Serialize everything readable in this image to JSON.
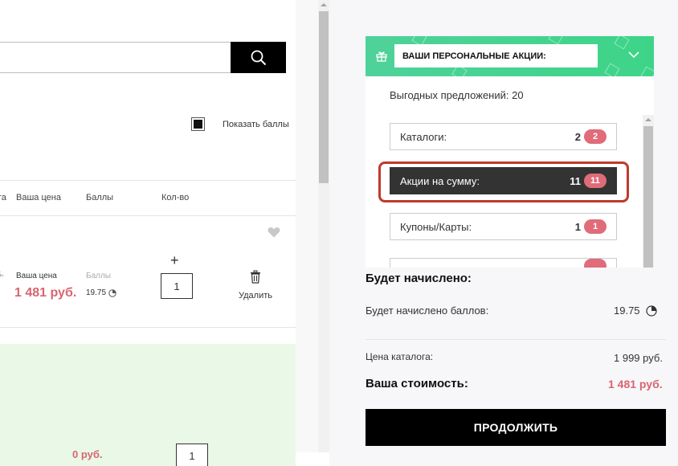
{
  "search": {
    "placeholder": ""
  },
  "show_points": {
    "label": "Показать баллы",
    "checked": true
  },
  "table_header": {
    "catalog_price_partial": "га",
    "your_price": "Ваша цена",
    "points": "Баллы",
    "qty": "Кол-во"
  },
  "item": {
    "old_price_partial": "5.",
    "current_price_partial": ".",
    "your_price_label": "Ваша цена",
    "your_price": "1 481 руб.",
    "points_label": "Баллы",
    "points_value": "19.75",
    "qty_increase": "+",
    "qty": "1",
    "delete_label": "Удалить"
  },
  "promo_band": {
    "price_partial": "0 руб.",
    "qty": "1"
  },
  "promo_panel": {
    "title": "ВАШИ ПЕРСОНАЛЬНЫЕ АКЦИИ:",
    "offers_count": "Выгодных предложений: 20",
    "categories": [
      {
        "label": "Каталоги:",
        "count": "2",
        "badge": "2",
        "active": false
      },
      {
        "label": "Акции на сумму:",
        "count": "11",
        "badge": "11",
        "active": true
      },
      {
        "label": "Купоны/Карты:",
        "count": "1",
        "badge": "1",
        "active": false
      }
    ]
  },
  "summary": {
    "accrue_title": "Будет начислено:",
    "accrue_points_label": "Будет начислено баллов:",
    "accrue_points_value": "19.75",
    "catalog_price_label": "Цена каталога:",
    "catalog_price_value": "1 999 руб.",
    "your_cost_label": "Ваша стоимость:",
    "your_cost_value": "1 481 руб.",
    "continue_label": "ПРОДОЛЖИТЬ"
  },
  "colors": {
    "accent_price": "#d9646f",
    "badge": "#e06b79",
    "promo_header": "#4fd29a",
    "highlight": "#c0392b"
  }
}
